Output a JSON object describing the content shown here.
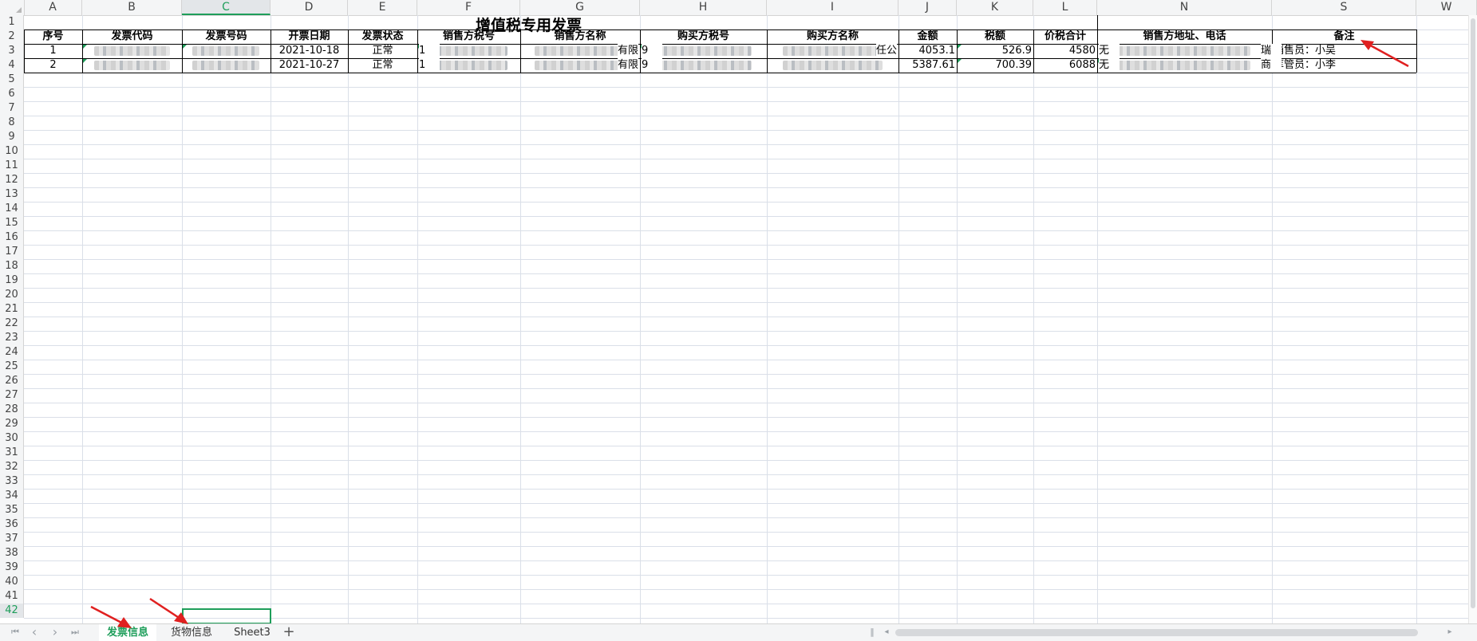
{
  "sheet": {
    "columns": [
      "A",
      "B",
      "C",
      "D",
      "E",
      "F",
      "G",
      "H",
      "I",
      "J",
      "K",
      "L",
      "N",
      "S",
      "W"
    ],
    "selected_column": "C",
    "row_numbers": [
      "1",
      "2",
      "3",
      "4",
      "5",
      "6",
      "7",
      "8",
      "9",
      "10",
      "11",
      "12",
      "13",
      "14",
      "15",
      "16",
      "17",
      "18",
      "19",
      "20",
      "21",
      "22",
      "23",
      "24",
      "25",
      "26",
      "27",
      "28",
      "29",
      "30",
      "31",
      "32",
      "33",
      "34",
      "35",
      "36",
      "37",
      "38",
      "39",
      "40",
      "41",
      "42"
    ],
    "selected_row": "42",
    "title": "增值税专用发票",
    "headers": [
      "序号",
      "发票代码",
      "发票号码",
      "开票日期",
      "发票状态",
      "销售方税号",
      "销售方名称",
      "购买方税号",
      "购买方名称",
      "金额",
      "税额",
      "价税合计",
      "销售方地址、电话",
      "备注"
    ],
    "rows": [
      {
        "seq": "1",
        "invoice_code": "",
        "invoice_number": "",
        "date": "2021-10-18",
        "status": "正常",
        "seller_tax_id": "",
        "seller_name": "",
        "buyer_tax_id": "",
        "buyer_name": "",
        "amount": "4053.1",
        "tax": "526.9",
        "total": "4580",
        "seller_address": "",
        "remark": "销售员：小吴"
      },
      {
        "seq": "2",
        "invoice_code": "",
        "invoice_number": "",
        "date": "2021-10-27",
        "status": "正常",
        "seller_tax_id": "",
        "seller_name": "",
        "buyer_tax_id": "",
        "buyer_name": "",
        "amount": "5387.61",
        "tax": "700.39",
        "total": "6088",
        "seller_address": "",
        "remark": "库管员：小李"
      }
    ],
    "visible_fragments": {
      "row1_seller_name_tail": "有限",
      "row2_seller_name_tail": "有限",
      "row1_buyer_name_tail": "任公",
      "row1_address_head": "无",
      "row2_address_head": "无",
      "row1_remark_overflow_char": "瑞",
      "row2_remark_overflow_char": "商",
      "row1_taxid_head": "1",
      "row2_taxid_head": "1",
      "row1_buyer_taxid_head": "9",
      "row2_buyer_taxid_head": "9"
    }
  },
  "tabbar": {
    "tabs": [
      {
        "label": "发票信息",
        "active": true
      },
      {
        "label": "货物信息",
        "active": false
      },
      {
        "label": "Sheet3",
        "active": false
      }
    ],
    "nav_first": "⏮",
    "nav_prev": "‹",
    "nav_next": "›",
    "nav_last": "⏭",
    "add_label": "+"
  },
  "colors": {
    "accent": "#1e9e5a",
    "arrow": "#e02020",
    "grid": "#dadfe8"
  }
}
